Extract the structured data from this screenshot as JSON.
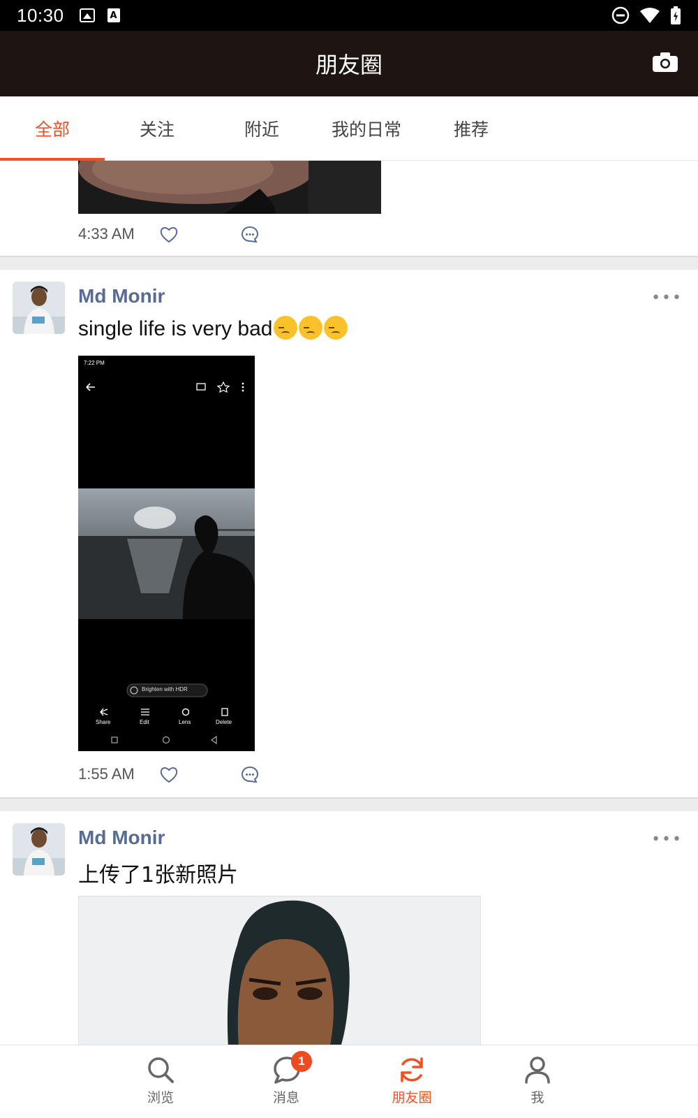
{
  "status_bar": {
    "time": "10:30",
    "left_icons": [
      "image-icon",
      "a-icon"
    ],
    "right_icons": [
      "do-not-disturb-icon",
      "wifi-icon",
      "battery-icon"
    ]
  },
  "header": {
    "title": "朋友圈",
    "right_icon": "camera-icon"
  },
  "tabs": [
    {
      "label": "全部",
      "active": true
    },
    {
      "label": "关注",
      "active": false
    },
    {
      "label": "附近",
      "active": false
    },
    {
      "label": "我的日常",
      "active": false
    },
    {
      "label": "推荐",
      "active": false
    }
  ],
  "posts": [
    {
      "time": "4:33 AM"
    },
    {
      "username": "Md Monir",
      "text": "single life is very bad",
      "emoji": "pensive-face",
      "emoji_count": 3,
      "time": "1:55 AM",
      "screenshot": {
        "status_time": "7:22 PM",
        "chip": "Brighten with HDR",
        "actions": [
          "Share",
          "Edit",
          "Lens",
          "Delete"
        ]
      }
    },
    {
      "username": "Md Monir",
      "text": "上传了1张新照片"
    }
  ],
  "bottom_nav": [
    {
      "label": "浏览",
      "icon": "search-icon",
      "active": false
    },
    {
      "label": "消息",
      "icon": "chat-icon",
      "active": false,
      "badge": "1"
    },
    {
      "label": "朋友圈",
      "icon": "refresh-icon",
      "active": true
    },
    {
      "label": "我",
      "icon": "person-icon",
      "active": false
    }
  ],
  "colors": {
    "accent": "#f25022",
    "username": "#576b95",
    "header_bg": "#1e1412"
  }
}
